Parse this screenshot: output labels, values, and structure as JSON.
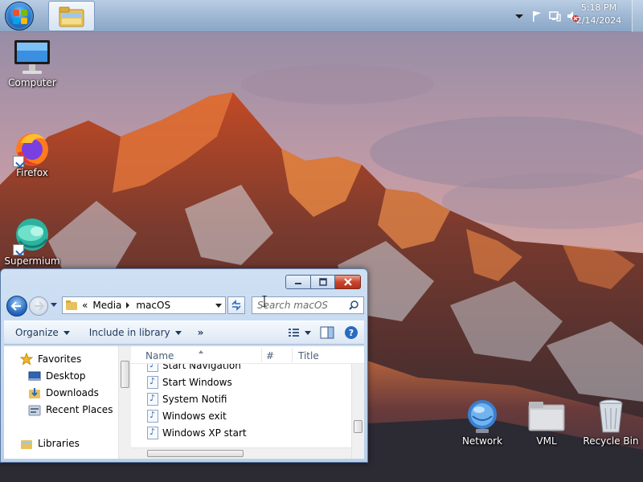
{
  "taskbar": {
    "clock_time": "5:18 PM",
    "clock_date": "2/14/2024",
    "pinned": [
      {
        "name": "Windows Explorer",
        "icon": "folder-library-icon"
      }
    ],
    "tray_icons": [
      "tray-overflow-arrow-icon",
      "action-center-flag-icon",
      "network-icon",
      "volume-muted-icon"
    ]
  },
  "desktop": {
    "icons": [
      {
        "label": "Computer",
        "icon": "computer-icon"
      },
      {
        "label": "Firefox",
        "icon": "firefox-icon"
      },
      {
        "label": "Supermium",
        "icon": "supermium-icon"
      },
      {
        "label": "Network",
        "icon": "network-globe-icon"
      },
      {
        "label": "VML",
        "icon": "folder-icon"
      },
      {
        "label": "Recycle Bin",
        "icon": "recycle-bin-icon"
      }
    ]
  },
  "explorer": {
    "address": {
      "overflow": "«",
      "crumbs": [
        "Media",
        "macOS"
      ]
    },
    "search_placeholder": "Search macOS",
    "commands": {
      "organize": "Organize",
      "include": "Include in library",
      "more": "»"
    },
    "nav": {
      "favorites": "Favorites",
      "items": [
        "Desktop",
        "Downloads",
        "Recent Places"
      ],
      "libraries": "Libraries"
    },
    "columns": {
      "name": "Name",
      "number": "#",
      "title": "Title"
    },
    "files": [
      "Start Navigation",
      "Start Windows",
      "System Notifi",
      "Windows exit",
      "Windows XP start"
    ]
  },
  "colors": {
    "accent": "#2a6bc1",
    "close_button": "#c9452c",
    "taskbar": "#9fb8d4"
  }
}
